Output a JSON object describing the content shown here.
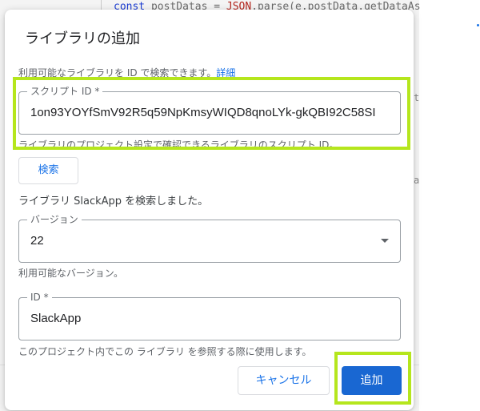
{
  "background": {
    "code_line": {
      "kw": "const",
      "rest1": " postDatas = ",
      "obj": "JSON",
      "rest2": ".parse(e.postData.getDataAs"
    },
    "frag_t": "t",
    "frag_a": "a"
  },
  "dialog": {
    "title": "ライブラリの追加",
    "info_text": "利用可能なライブラリを ID で検索できます。",
    "info_link": "詳細",
    "script_id": {
      "label": "スクリプト ID *",
      "value": "1on93YOYfSmV92R5q59NpKmsyWIQD8qnoLYk-gkQBI92C58SI",
      "helper": "ライブラリのプロジェクト設定で確認できるライブラリのスクリプト ID。"
    },
    "search_button": "検索",
    "status": "ライブラリ SlackApp を検索しました。",
    "version": {
      "label": "バージョン",
      "value": "22",
      "helper": "利用可能なバージョン。"
    },
    "identifier": {
      "label": "ID *",
      "value": "SlackApp",
      "helper": "このプロジェクト内でこの ライブラリ を参照する際に使用します。"
    },
    "cancel_button": "キャンセル",
    "add_button": "追加"
  },
  "colors": {
    "accent": "#1a73e8",
    "primary_button": "#1967d2",
    "highlight": "#b5e61d"
  }
}
